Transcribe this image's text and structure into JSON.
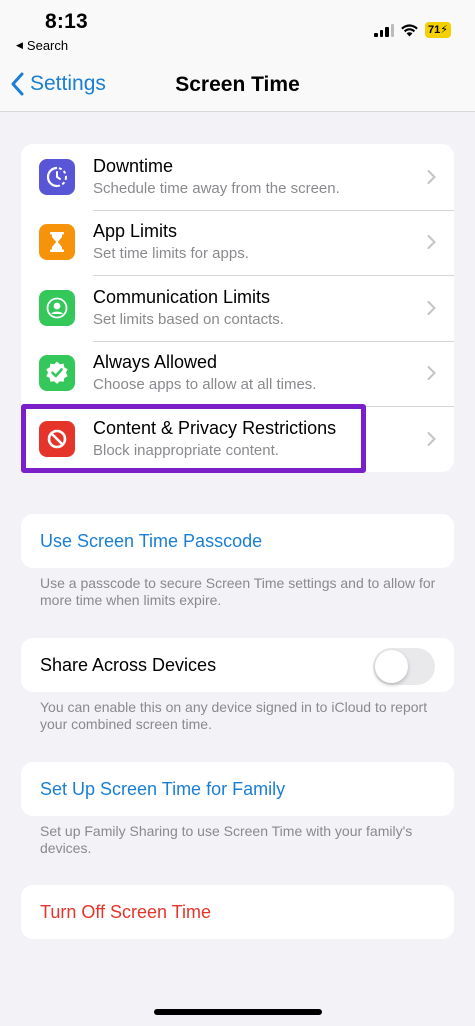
{
  "status_bar": {
    "time": "8:13",
    "back_app": "Search",
    "battery": "71"
  },
  "nav": {
    "back_label": "Settings",
    "title": "Screen Time"
  },
  "menu_items": [
    {
      "title": "Downtime",
      "subtitle": "Schedule time away from the screen.",
      "icon": "downtime-icon",
      "color": "#5856d6"
    },
    {
      "title": "App Limits",
      "subtitle": "Set time limits for apps.",
      "icon": "hourglass-icon",
      "color": "#f7930a"
    },
    {
      "title": "Communication Limits",
      "subtitle": "Set limits based on contacts.",
      "icon": "contact-icon",
      "color": "#34c759"
    },
    {
      "title": "Always Allowed",
      "subtitle": "Choose apps to allow at all times.",
      "icon": "checkmark-badge-icon",
      "color": "#34c759"
    },
    {
      "title": "Content & Privacy Restrictions",
      "subtitle": "Block inappropriate content.",
      "icon": "restriction-icon",
      "color": "#e5352b"
    }
  ],
  "passcode": {
    "label": "Use Screen Time Passcode",
    "footnote": "Use a passcode to secure Screen Time settings and to allow for more time when limits expire."
  },
  "share": {
    "label": "Share Across Devices",
    "enabled": false,
    "footnote": "You can enable this on any device signed in to iCloud to report your combined screen time."
  },
  "family": {
    "label": "Set Up Screen Time for Family",
    "footnote": "Set up Family Sharing to use Screen Time with your family's devices."
  },
  "turn_off": {
    "label": "Turn Off Screen Time"
  },
  "colors": {
    "accent": "#1a7fd4",
    "destructive": "#e5352b",
    "highlight": "#7a1fc9"
  }
}
